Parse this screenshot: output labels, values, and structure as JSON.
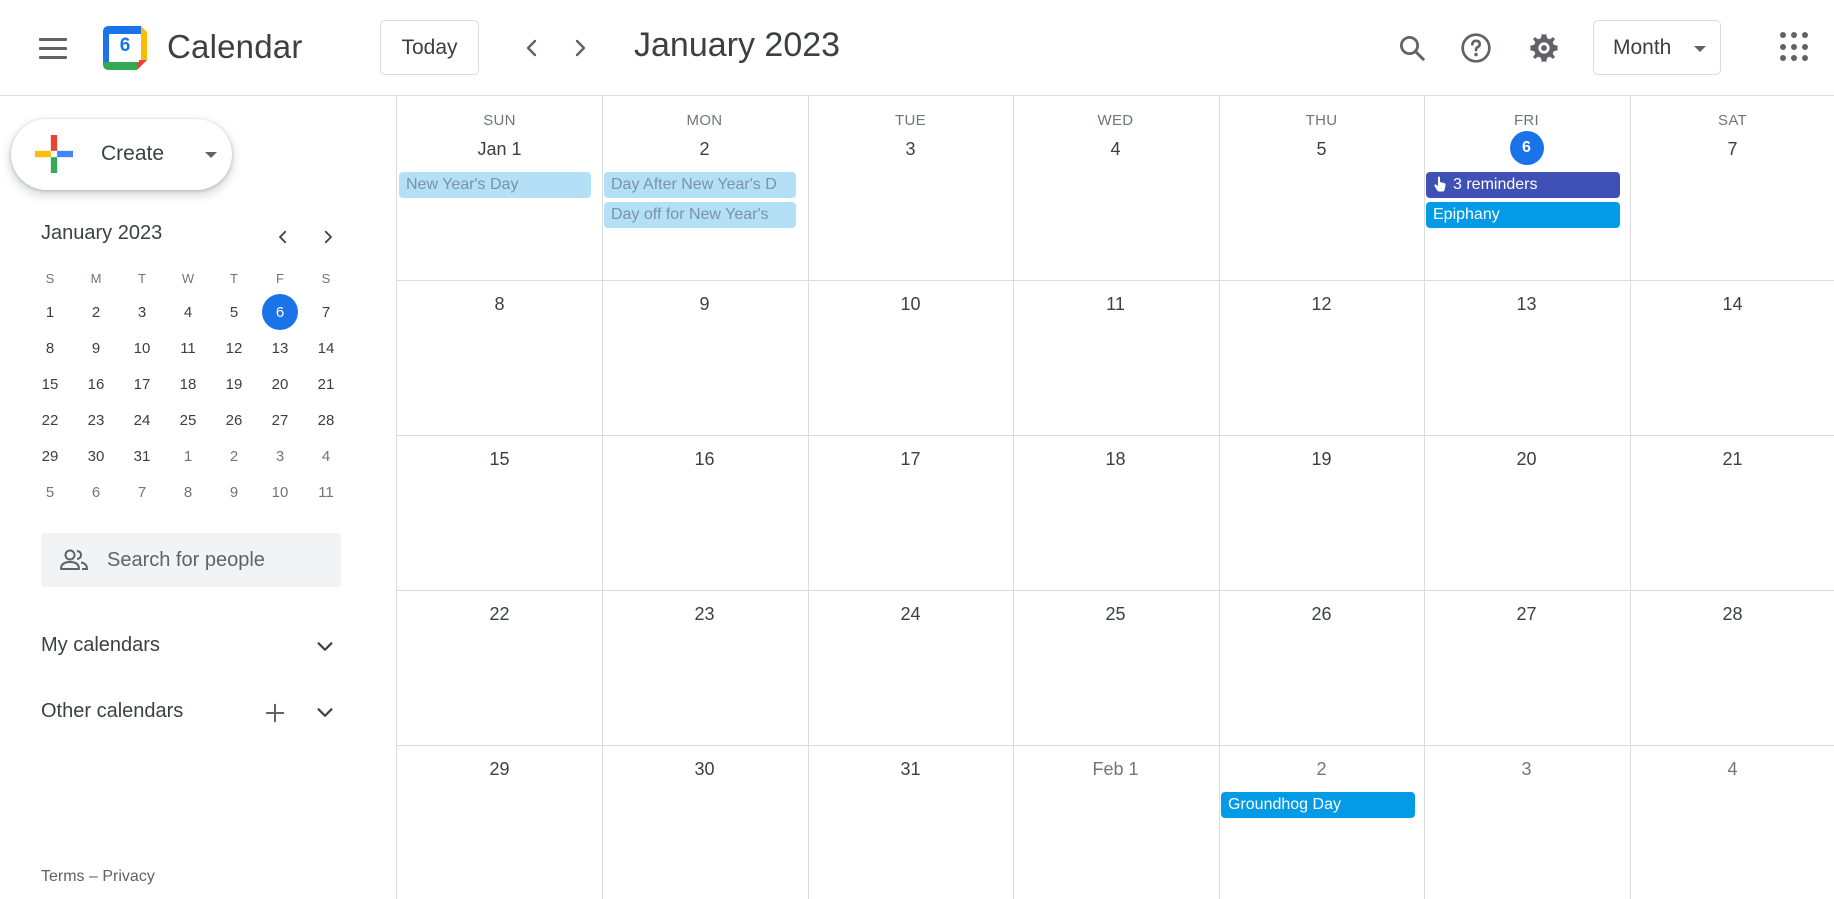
{
  "header": {
    "app_title": "Calendar",
    "logo_day": "6",
    "today_label": "Today",
    "period_title": "January 2023",
    "view_label": "Month"
  },
  "sidebar": {
    "create_label": "Create",
    "mini_calendar": {
      "title": "January 2023",
      "dow": [
        "S",
        "M",
        "T",
        "W",
        "T",
        "F",
        "S"
      ],
      "weeks": [
        [
          "1",
          "2",
          "3",
          "4",
          "5",
          "6",
          "7"
        ],
        [
          "8",
          "9",
          "10",
          "11",
          "12",
          "13",
          "14"
        ],
        [
          "15",
          "16",
          "17",
          "18",
          "19",
          "20",
          "21"
        ],
        [
          "22",
          "23",
          "24",
          "25",
          "26",
          "27",
          "28"
        ],
        [
          "29",
          "30",
          "31",
          "1",
          "2",
          "3",
          "4"
        ],
        [
          "5",
          "6",
          "7",
          "8",
          "9",
          "10",
          "11"
        ]
      ],
      "today": "6"
    },
    "search_people_placeholder": "Search for people",
    "my_calendars_label": "My calendars",
    "other_calendars_label": "Other calendars",
    "footer_terms": "Terms",
    "footer_sep": " – ",
    "footer_privacy": "Privacy"
  },
  "month": {
    "dow": [
      "SUN",
      "MON",
      "TUE",
      "WED",
      "THU",
      "FRI",
      "SAT"
    ],
    "weeks": [
      [
        "Jan 1",
        "2",
        "3",
        "4",
        "5",
        "6",
        "7"
      ],
      [
        "8",
        "9",
        "10",
        "11",
        "12",
        "13",
        "14"
      ],
      [
        "15",
        "16",
        "17",
        "18",
        "19",
        "20",
        "21"
      ],
      [
        "22",
        "23",
        "24",
        "25",
        "26",
        "27",
        "28"
      ],
      [
        "29",
        "30",
        "31",
        "Feb 1",
        "2",
        "3",
        "4"
      ]
    ],
    "today_label": "6",
    "events": {
      "new_years_day": "New Year's Day",
      "day_after_new_year": "Day After New Year's D",
      "day_off_new_year": "Day off for New Year's",
      "reminders": "3 reminders",
      "epiphany": "Epiphany",
      "groundhog_day": "Groundhog Day"
    }
  },
  "colors": {
    "accent": "#1a73e8",
    "event_blue": "#039be5",
    "event_indigo": "#3f51b5",
    "event_past": "#b3e0f7"
  }
}
